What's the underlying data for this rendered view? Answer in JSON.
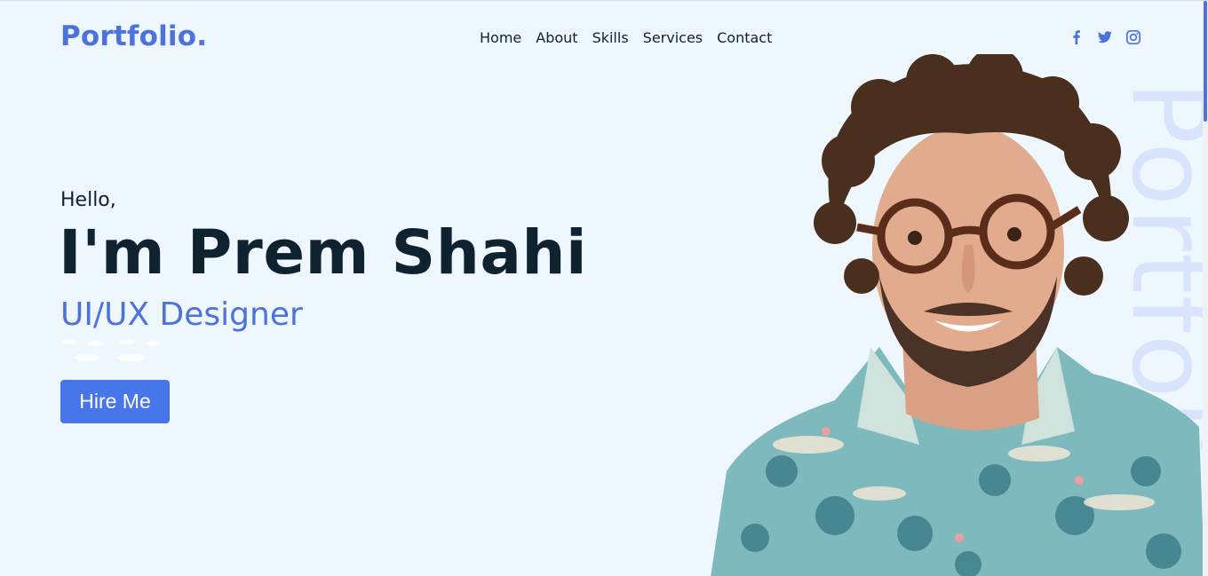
{
  "header": {
    "logo": "Portfolio.",
    "nav": [
      "Home",
      "About",
      "Skills",
      "Services",
      "Contact"
    ],
    "social_icons": [
      "facebook-icon",
      "twitter-icon",
      "instagram-icon"
    ]
  },
  "hero": {
    "greeting": "Hello,",
    "name": "I'm Prem Shahi",
    "role": "UI/UX Designer",
    "button_label": "Hire Me",
    "watermark": "Portfolio"
  },
  "colors": {
    "accent": "#4b73db",
    "button": "#4775ea",
    "background": "#eff7fe",
    "text": "#0e2230"
  }
}
